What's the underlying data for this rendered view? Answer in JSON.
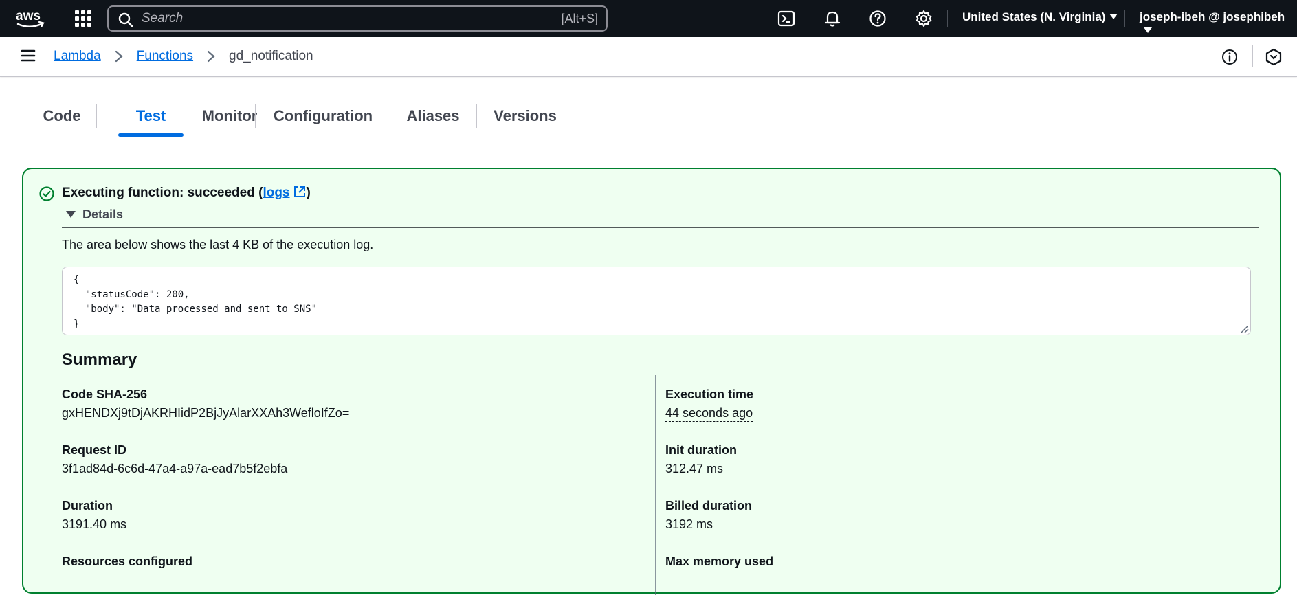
{
  "topnav": {
    "search_placeholder": "Search",
    "search_shortcut": "[Alt+S]",
    "region": "United States (N. Virginia)",
    "user": "joseph-ibeh @ josephibeh",
    "icons": [
      "cloudshell-icon",
      "notifications-bell-icon",
      "help-icon",
      "settings-gear-icon"
    ]
  },
  "breadcrumb": {
    "items": [
      "Lambda",
      "Functions"
    ],
    "current": "gd_notification"
  },
  "tabs": [
    "Code",
    "Test",
    "Monitor",
    "Configuration",
    "Aliases",
    "Versions"
  ],
  "active_tab": "Test",
  "result": {
    "status_prefix": "Executing function: succeeded (",
    "logs_link": "logs",
    "status_suffix": ")",
    "details_label": "Details",
    "log_note": "The area below shows the last 4 KB of the execution log.",
    "log_output": "{\n  \"statusCode\": 200,\n  \"body\": \"Data processed and sent to SNS\"\n}",
    "success_color": "#00802f",
    "panel_bg": "#effff1"
  },
  "summary": {
    "title": "Summary",
    "code_sha_label": "Code SHA-256",
    "code_sha_value": "gxHENDXj9tDjAKRHIidP2BjJyAlarXXAh3WefloIfZo=",
    "request_id_label": "Request ID",
    "request_id_value": "3f1ad84d-6c6d-47a4-a97a-ead7b5f2ebfa",
    "duration_label": "Duration",
    "duration_value": "3191.40 ms",
    "resources_label": "Resources configured",
    "execution_time_label": "Execution time",
    "execution_time_value": "44 seconds ago",
    "init_duration_label": "Init duration",
    "init_duration_value": "312.47 ms",
    "billed_duration_label": "Billed duration",
    "billed_duration_value": "3192 ms",
    "max_memory_label": "Max memory used"
  },
  "colors": {
    "nav_bg": "#0f141a",
    "link": "#006ce0",
    "text": "#0f141a"
  }
}
